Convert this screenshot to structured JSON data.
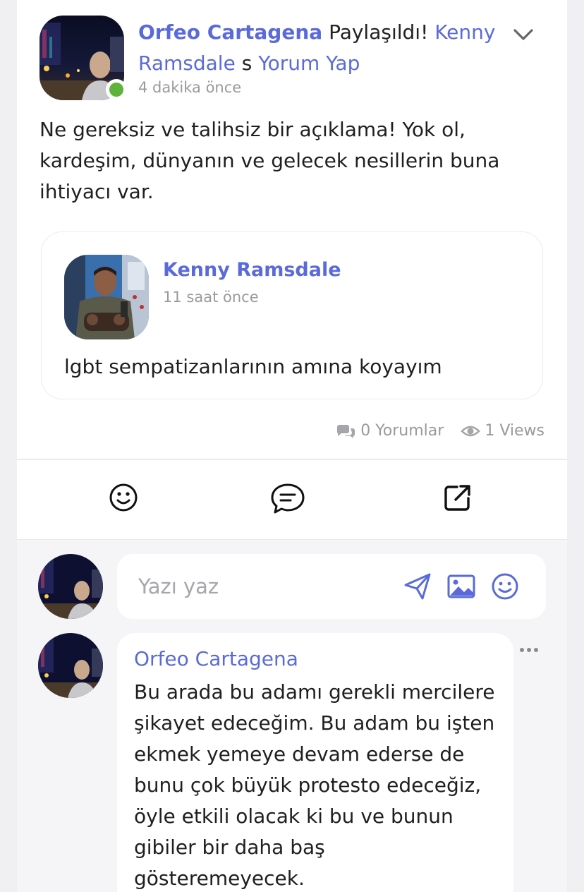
{
  "post": {
    "author": "Orfeo Cartagena",
    "action_text": "Paylaşıldı!",
    "shared_from": "Kenny Ramsdale",
    "possessive": "s",
    "comment_link": "Yorum Yap",
    "time": "4 dakika önce",
    "text": "Ne gereksiz ve talihsiz bir açıklama! Yok ol, kardeşim, dünyanın ve gelecek nesillerin buna ihtiyacı var.",
    "online_status_color": "#5fb33a"
  },
  "shared_post": {
    "author": "Kenny Ramsdale",
    "time": "11 saat önce",
    "text": "lgbt sempatizanlarının amına koyayım"
  },
  "stats": {
    "comments": "0 Yorumlar",
    "views": "1 Views"
  },
  "actions": {
    "react_icon": "smiley-icon",
    "comment_icon": "comment-bubble-icon",
    "share_icon": "share-external-icon"
  },
  "composer": {
    "placeholder": "Yazı yaz",
    "icons": [
      "send-icon",
      "image-icon",
      "emoji-icon"
    ]
  },
  "comments": [
    {
      "author": "Orfeo Cartagena",
      "text": "Bu arada bu adamı gerekli mercilere şikayet edeceğim. Bu adam bu işten ekmek yemeye devam ederse de bunu çok büyük protesto edeceğiz, öyle etkili olacak ki bu ve bunun gibiler bir daha baş gösteremeyecek."
    }
  ],
  "colors": {
    "accent": "#5a6bd9",
    "muted": "#9a9a9a",
    "background": "#f0f0f2"
  }
}
